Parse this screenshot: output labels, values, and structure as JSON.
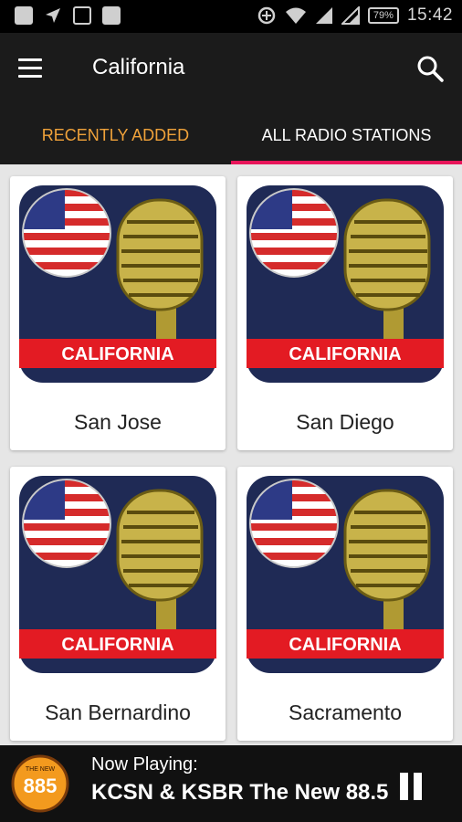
{
  "status_bar": {
    "time": "15:42",
    "battery": "79%",
    "left_icons": [
      "notification-icon",
      "navigation-icon",
      "image-icon",
      "app-icon"
    ],
    "right_icons": [
      "data-saver-icon",
      "wifi-icon",
      "signal-icon",
      "signal-2-icon"
    ]
  },
  "app_bar": {
    "title": "California",
    "menu_icon": "hamburger-menu-icon",
    "search_icon": "search-icon"
  },
  "tabs": [
    {
      "label": "RECENTLY ADDED",
      "active": false,
      "color": "#f0a23a"
    },
    {
      "label": "ALL RADIO STATIONS",
      "active": true,
      "indicator_color": "#e8155a"
    }
  ],
  "stations": [
    {
      "name": "San Jose",
      "banner": "CALIFORNIA"
    },
    {
      "name": "San Diego",
      "banner": "CALIFORNIA"
    },
    {
      "name": "San Bernardino",
      "banner": "CALIFORNIA"
    },
    {
      "name": "Sacramento",
      "banner": "CALIFORNIA"
    }
  ],
  "player": {
    "label": "Now Playing:",
    "title": "KCSN & KSBR The New 88.5",
    "logo_text": "885",
    "logo_small_text": "THE NEW",
    "pause_icon": "pause-icon"
  },
  "colors": {
    "app_bar": "#1b1b1b",
    "tab_active_indicator": "#e8155a",
    "tab_inactive_text": "#f0a23a",
    "thumb_bg": "#1f2a55",
    "banner_red": "#e31b23"
  }
}
